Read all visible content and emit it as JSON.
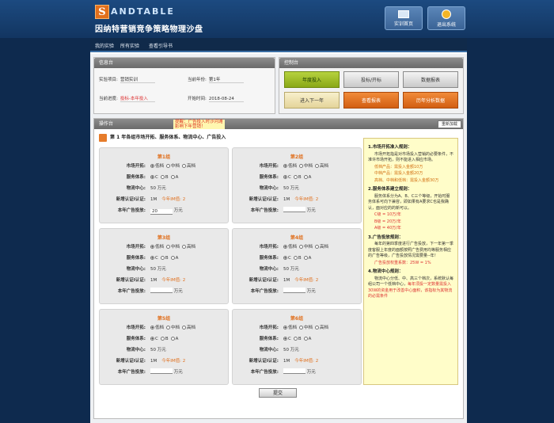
{
  "header": {
    "logo_letter": "S",
    "logo_word": "ANDTABLE",
    "subtitle": "因纳特营销竞争策略物理沙盘",
    "home_label": "实训首页",
    "exit_label": "退出系统"
  },
  "nav": {
    "items": [
      "我的实验",
      "所有实验",
      "查看引导书"
    ]
  },
  "info": {
    "header": "信息台",
    "rows": [
      {
        "label": "实验项目:",
        "value": "营销实训"
      },
      {
        "label": "当前年份:",
        "value": "第1年"
      },
      {
        "label": "当前进度:",
        "value": "投标-本年投入"
      },
      {
        "label": "开始时间:",
        "value": "2018-08-24"
      }
    ]
  },
  "control": {
    "header": "控制台",
    "buttons": [
      "年度投入",
      "投标/开标",
      "数据报表",
      "进入下一年",
      "查看报表",
      "历年分析数据"
    ]
  },
  "ops": {
    "header": "操作台",
    "hint_line1": "提醒：广告投入时沙河滩",
    "hint_line2": "影响下年营销！",
    "reload_label": "重新加载",
    "title": "第 1 年各组市场开拓、服务体系、物流中心、广告投入",
    "submit_label": "提交",
    "labels": {
      "market": "市场开拓:",
      "service": "服务体系:",
      "logistics": "物流中心:",
      "new_certify": "新增认证I认证:",
      "ad_invest": "本年广告投放:"
    },
    "market_opts": [
      "低档",
      "中档",
      "高档"
    ],
    "service_opts": [
      "C",
      "B",
      "A"
    ],
    "unit": "万元",
    "certify_amt": "1M",
    "certify_note": "今年IM值: 2",
    "groups": [
      {
        "name": "第1组",
        "logistics": "50",
        "ad": "20"
      },
      {
        "name": "第2组",
        "logistics": "50",
        "ad": ""
      },
      {
        "name": "第3组",
        "logistics": "50",
        "ad": ""
      },
      {
        "name": "第4组",
        "logistics": "50",
        "ad": ""
      },
      {
        "name": "第5组",
        "logistics": "50",
        "ad": ""
      },
      {
        "name": "第6组",
        "logistics": "50",
        "ad": ""
      }
    ]
  },
  "rules": {
    "s1_title": "1.市场开拓准入规则：",
    "s1_text": "市场开拓指是对市场投入营销的必要条件，不准许市场开拓，则不能进入相应市场。",
    "s1_low": "低档产品：需投入金额10万",
    "s1_mid": "中档产品：需投入金额20万",
    "s1_high": "高档、中档和低档：需投入金额30万",
    "s2_title": "2.服务体系建立规则：",
    "s2_text": "服务体系分为A、B、C三个等级，开始时服务体系可向下兼容，即如果有A要求C也是我确认，面对应的的新可以。",
    "s2_c": "C级 = 10万/年",
    "s2_b": "B级 = 20万/年",
    "s2_a": "A级 = 40万/年",
    "s3_title": "3.广告投放规则：",
    "s3_text": "每年的第四季度进行广告投放，下一年第一季度客服上年度的面额按照广告费用均等服务相应的广告等级，广告投放情况需要量--年！",
    "s3_note": "广告投放权重系数：25W = 1%",
    "s4_title": "4.物流中心规则：",
    "s4_text": "物流中心分低、中、高三个档次，系统默认每组公司一个低档中心，",
    "s4_red": "每年须投一定数量需投入30W的资金用于改善中心面积，该指标为其物流的必需条件"
  }
}
